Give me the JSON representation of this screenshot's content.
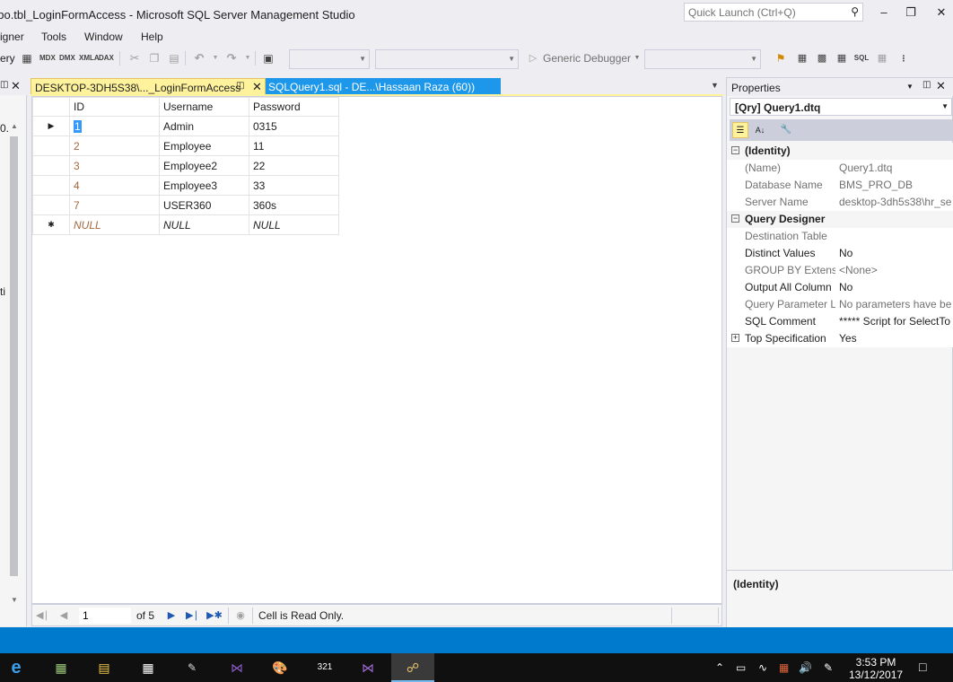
{
  "window": {
    "title": "dbo.tbl_LoginFormAccess - Microsoft SQL Server Management Studio",
    "quick_launch_placeholder": "Quick Launch (Ctrl+Q)"
  },
  "menu": [
    "igner",
    "Tools",
    "Window",
    "Help"
  ],
  "toolbar": {
    "query_type_label": "ery",
    "debugger_label": "Generic Debugger",
    "sql_label": "SQL"
  },
  "tabs": {
    "active": "DESKTOP-3DH5S38\\..._LoginFormAccess",
    "inactive": "SQLQuery1.sql - DE...\\Hassaan Raza (60))"
  },
  "grid": {
    "columns": [
      "ID",
      "Username",
      "Password"
    ],
    "rows": [
      {
        "id": "1",
        "username": "Admin",
        "password": "0315"
      },
      {
        "id": "2",
        "username": "Employee",
        "password": "11"
      },
      {
        "id": "3",
        "username": "Employee2",
        "password": "22"
      },
      {
        "id": "4",
        "username": "Employee3",
        "password": "33"
      },
      {
        "id": "7",
        "username": "USER360",
        "password": "360s"
      }
    ],
    "new_row": {
      "id": "NULL",
      "username": "NULL",
      "password": "NULL"
    }
  },
  "navigator": {
    "current_record": "1",
    "of_text": "of 5",
    "status": "Cell is Read Only."
  },
  "properties": {
    "title": "Properties",
    "object": "[Qry] Query1.dtq",
    "categories": [
      {
        "name": "(Identity)",
        "expanded": true,
        "items": [
          {
            "name": "(Name)",
            "value": "Query1.dtq",
            "dim": true
          },
          {
            "name": "Database Name",
            "value": "BMS_PRO_DB",
            "dim": true
          },
          {
            "name": "Server Name",
            "value": "desktop-3dh5s38\\hr_se",
            "dim": true
          }
        ]
      },
      {
        "name": "Query Designer",
        "expanded": true,
        "items": [
          {
            "name": "Destination Table",
            "value": "",
            "dim": true
          },
          {
            "name": "Distinct Values",
            "value": "No",
            "dim": false
          },
          {
            "name": "GROUP BY Extensic",
            "value": "<None>",
            "dim": true
          },
          {
            "name": "Output All Column",
            "value": "No",
            "dim": false
          },
          {
            "name": "Query Parameter Li",
            "value": "No parameters have be",
            "dim": true
          },
          {
            "name": "SQL Comment",
            "value": "***** Script for SelectTo",
            "dim": false
          }
        ]
      }
    ],
    "collapsed_row": {
      "name": "Top Specification",
      "value": "Yes"
    },
    "description_title": "(Identity)"
  },
  "taskbar": {
    "time": "3:53 PM",
    "date": "13/12/2017"
  },
  "colors": {
    "accent": "#007ACC",
    "tab_active": "#FFF29D",
    "tab_inactive": "#1C97EA",
    "selection": "#3399FF"
  }
}
